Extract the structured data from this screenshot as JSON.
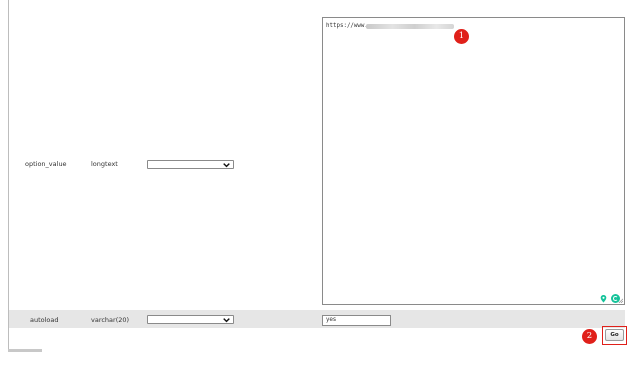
{
  "rows": [
    {
      "column": "option_value",
      "type": "longtext",
      "function_select": "",
      "value": "https://www."
    },
    {
      "column": "autoload",
      "type": "varchar(20)",
      "function_select": "",
      "value": "yes"
    }
  ],
  "annotations": [
    "1",
    "2"
  ],
  "submit": {
    "label": "Go"
  },
  "colors": {
    "annotation": "#e0201a",
    "row_highlight": "#e6e6e6",
    "grammarly": "#15c39a"
  },
  "icons": [
    "chevron-down-icon",
    "location-pin-icon",
    "grammarly-icon",
    "resize-handle-icon"
  ]
}
